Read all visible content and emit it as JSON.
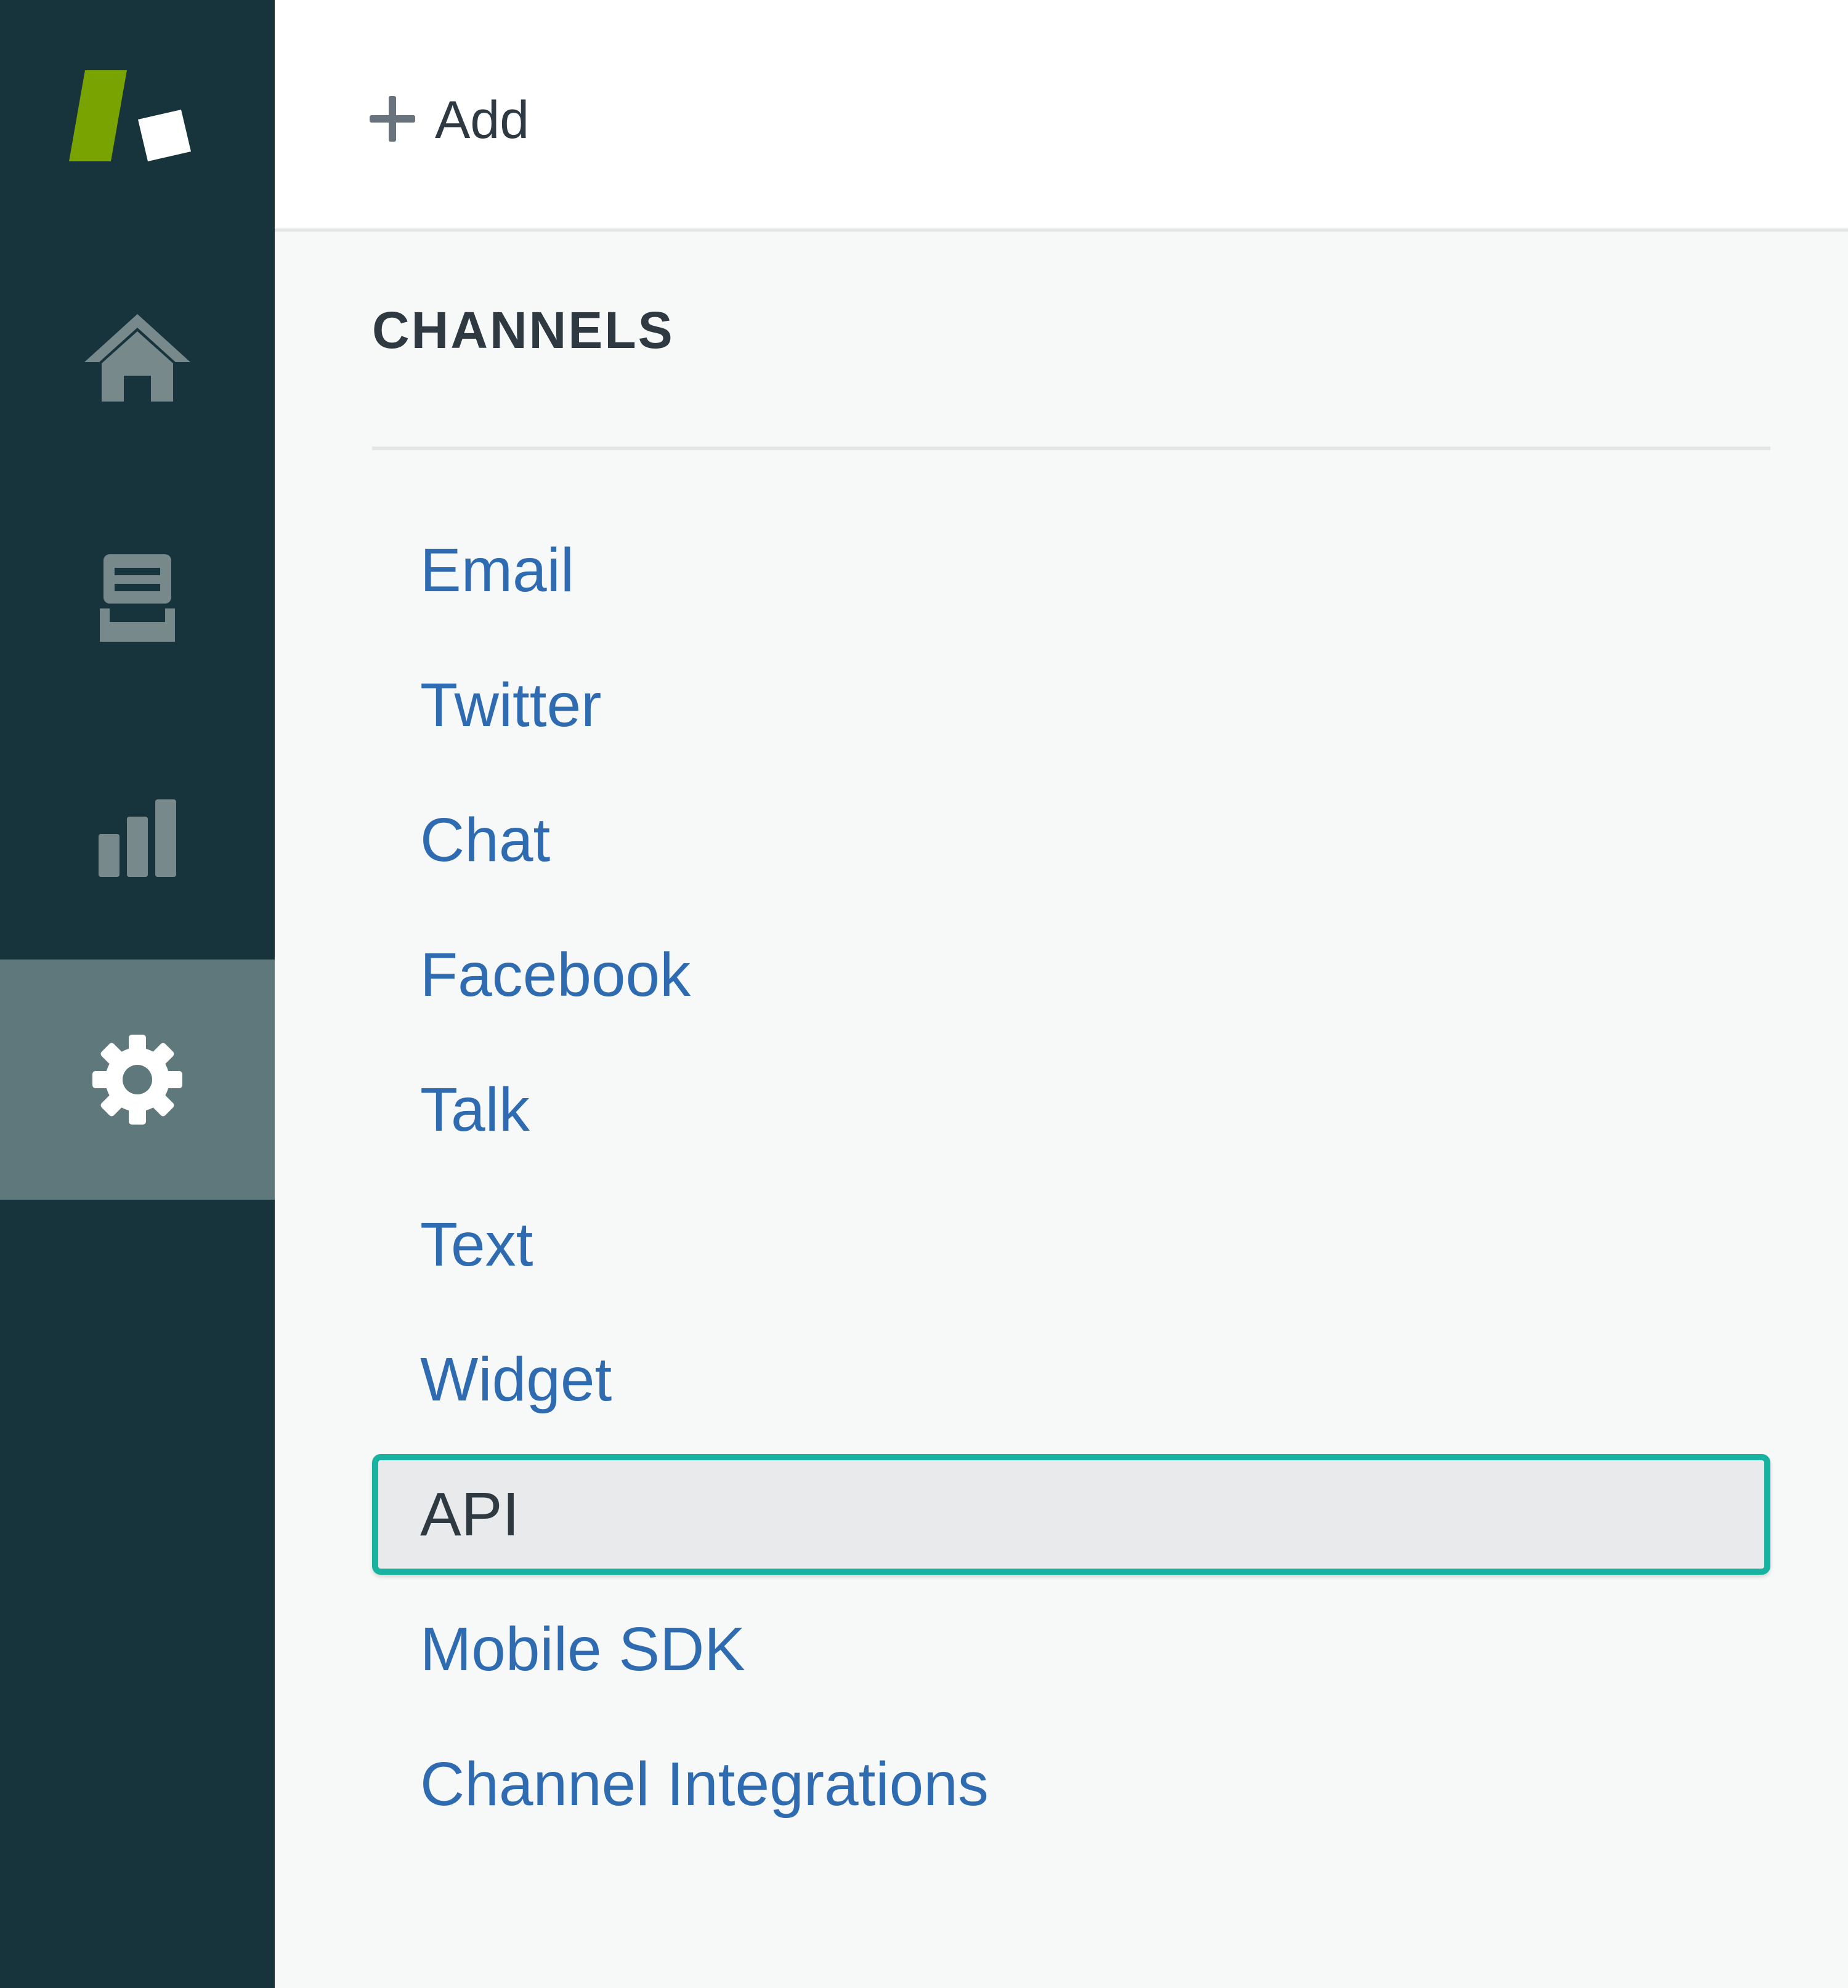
{
  "colors": {
    "sidebar_bg": "#17333b",
    "sidebar_active_bg": "#5f787c",
    "logo_green": "#78a300",
    "link_blue": "#2f6bb1",
    "selected_border": "#17b3a0",
    "text_dark": "#2f3941"
  },
  "sidebar": {
    "logo": "zendesk-logo",
    "items": [
      {
        "icon": "home-icon",
        "active": false
      },
      {
        "icon": "views-inbox-icon",
        "active": false
      },
      {
        "icon": "reporting-bar-chart-icon",
        "active": false
      },
      {
        "icon": "admin-gear-icon",
        "active": true
      }
    ]
  },
  "header": {
    "add_label": "Add",
    "add_icon": "plus-icon"
  },
  "channels": {
    "title": "CHANNELS",
    "items": [
      {
        "label": "Email",
        "selected": false
      },
      {
        "label": "Twitter",
        "selected": false
      },
      {
        "label": "Chat",
        "selected": false
      },
      {
        "label": "Facebook",
        "selected": false
      },
      {
        "label": "Talk",
        "selected": false
      },
      {
        "label": "Text",
        "selected": false
      },
      {
        "label": "Widget",
        "selected": false
      },
      {
        "label": "API",
        "selected": true
      },
      {
        "label": "Mobile SDK",
        "selected": false
      },
      {
        "label": "Channel Integrations",
        "selected": false
      }
    ]
  }
}
